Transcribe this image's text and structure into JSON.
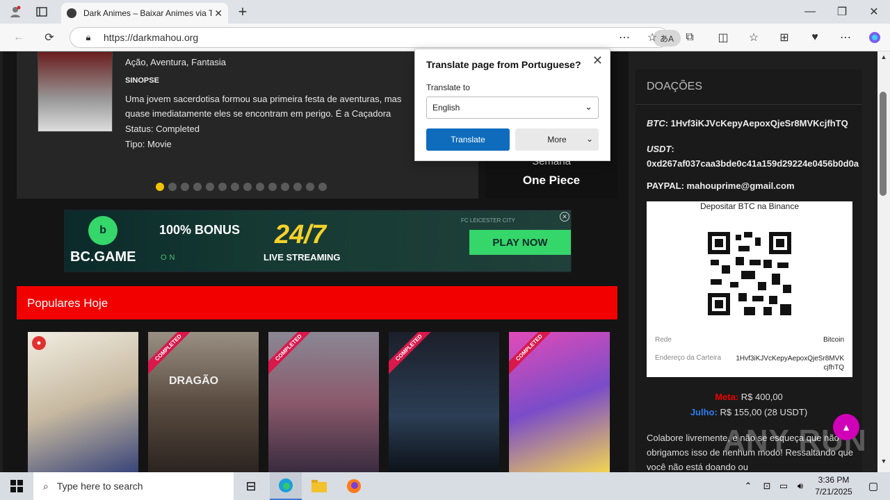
{
  "browser": {
    "tab_title": "Dark Animes – Baixar Animes via T",
    "url": "https://darkmahou.org",
    "translate_pill": "あA"
  },
  "slider": {
    "genres": "Ação, Aventura, Fantasia",
    "sinopse_heading": "SINOPSE",
    "sinopse_text": "Uma jovem sacerdotisa formou sua primeira festa de aventuras, mas quase imediatamente eles se encontram em perigo. É a Caçadora",
    "status": "Status: Completed",
    "tipo": "Tipo: Movie",
    "side_line1": "Semana",
    "side_line2": "One Piece"
  },
  "ad": {
    "brand": "BC.GAME",
    "bonus": "100% BONUS",
    "twentyfour": "24/7",
    "live": "LIVE STREAMING",
    "on": "ON",
    "club": "FC LEICESTER CITY",
    "play": "PLAY NOW",
    "adx": "✕"
  },
  "popular": {
    "title": "Populares Hoje",
    "ribbon": "COMPLETED",
    "card2_text": "DRAGÃO"
  },
  "sidebar": {
    "heading": "DOAÇÕES",
    "btc_label": "BTC",
    "btc_value": "1Hvf3iKJVcKepyAepoxQjeSr8MVKcjfhTQ",
    "usdt_label": "USDT",
    "usdt_value": "0xd267af037caa3bde0c41a159d29224e0456b0d0a",
    "paypal": "PAYPAL: mahouprime@gmail.com",
    "qr_title": "Depositar BTC na Binance",
    "rede_label": "Rede",
    "rede_value": "Bitcoin",
    "endereco_label": "Endereço da Carteira",
    "endereco_value": "1Hvf3iKJVcKepyAepoxQjeSr8MVKcjfhTQ",
    "meta_label": "Meta:",
    "meta_value": " R$ 400,00",
    "julho_label": "Julho:",
    "julho_value": " R$ 155,00 (28 USDT)",
    "colab": "Colabore livremente, e não se esqueça que não obrigamos isso de nenhum modo! Ressaltando que você não está doando ou"
  },
  "translate_popup": {
    "heading": "Translate page from Portuguese?",
    "label": "Translate to",
    "language": "English",
    "translate_btn": "Translate",
    "more_btn": "More"
  },
  "watermark": "ANY RUN",
  "taskbar": {
    "search_placeholder": "Type here to search",
    "time": "3:36 PM",
    "date": "7/21/2025"
  }
}
